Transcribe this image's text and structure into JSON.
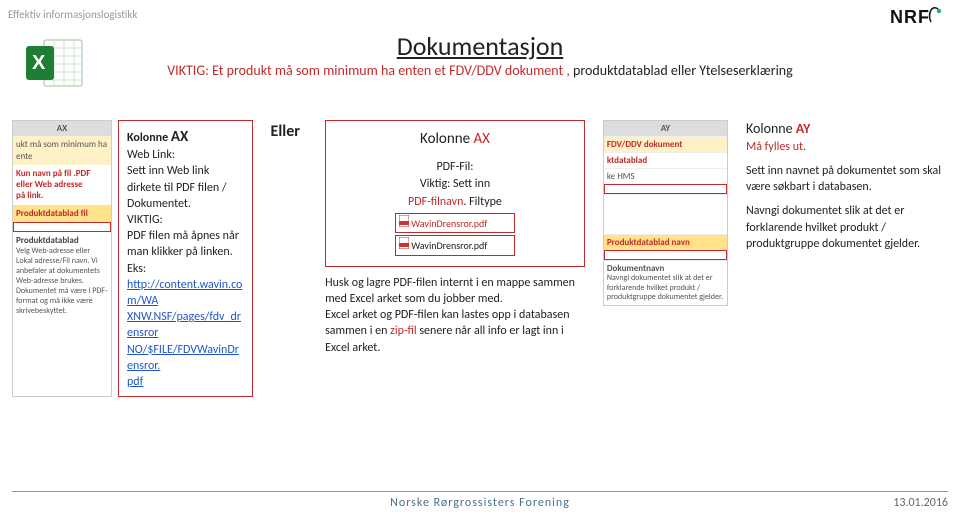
{
  "header": {
    "band": "Effektiv informasjonslogistikk",
    "logo_text": "NRF",
    "title": "Dokumentasjon",
    "subtitle_red": "VIKTIG: Et produkt må som minimum ha enten et FDV/DDV dokument ,",
    "subtitle_plain": " produktdatablad eller Ytelseserklæring"
  },
  "eller": "Eller",
  "col1": {
    "heading_prefix": "Kolonne ",
    "heading_col": "AX",
    "weblink_label": "Web Link:",
    "weblink_text": "Sett inn Web link dirkete til PDF filen / Dokumentet.",
    "viktig_label": "VIKTIG:",
    "viktig_text": "PDF filen må åpnes når man klikker på linken.",
    "eks_label": "Eks:",
    "link_line1": "http://content.wavin.com/WA",
    "link_line2": "XNW.NSF/pages/fdv_drensror",
    "link_line3": "NO/$FILE/FDVWavinDrensror.",
    "link_line4": "pdf"
  },
  "leftimg": {
    "colhead": "AX",
    "row1": "ukt må som minimum ha ente",
    "row2a": "Kun navn på fil .PDF",
    "row2b": "eller Web adresse",
    "row2c": "på link.",
    "row3": "Produktdatablad fil",
    "row4": "Produktdatablad",
    "row4t": "Velg Web-adresse eller Lokal adresse/Fil navn. Vi anbefaler at dokumentets Web-adresse brukes. Dokumentet må være i PDF-format og må ikke være skrivebeskyttet."
  },
  "col2": {
    "heading_prefix": "Kolonne ",
    "heading_col": "AX",
    "pdf_fil_label": "PDF-Fil:",
    "viktig_sett": "Viktig: Sett inn",
    "filnavn": "PDF-filnavn",
    "filtype": ". Filtype",
    "file_a": "WavinDrensror.pdf",
    "file_b": "WavinDrensror.pdf",
    "note1a": "Husk og lagre PDF-filen internt i en mappe sammen med Excel arket som du jobber med.",
    "note1b_a": "Excel arket og PDF-filen kan lastes opp i databasen sammen i en ",
    "note1b_zip": "zip-fil",
    "note1b_b": " senere når all info er lagt inn i Excel arket."
  },
  "col3": {
    "colhead": "AY",
    "r1": "FDV/DDV dokument",
    "r2": "ktdatablad",
    "r3": "ke HMS",
    "r4": "Produktdatablad navn",
    "r5": "Dokumentnavn",
    "r5t": "Navngi dokumentet slik at det er forklarende hvilket produkt / produktgruppe dokumentet gjelder."
  },
  "col4": {
    "heading_prefix": "Kolonne ",
    "heading_col": "AY",
    "must": "Må fylles ut.",
    "p1": "Sett inn navnet på dokumentet som skal være søkbart i databasen.",
    "p2": "Navngi dokumentet slik at det er forklarende hvilket produkt / produktgruppe dokumentet gjelder."
  },
  "footer": {
    "center": "Norske Rørgrossisters Forening",
    "right": "13.01.2016"
  }
}
